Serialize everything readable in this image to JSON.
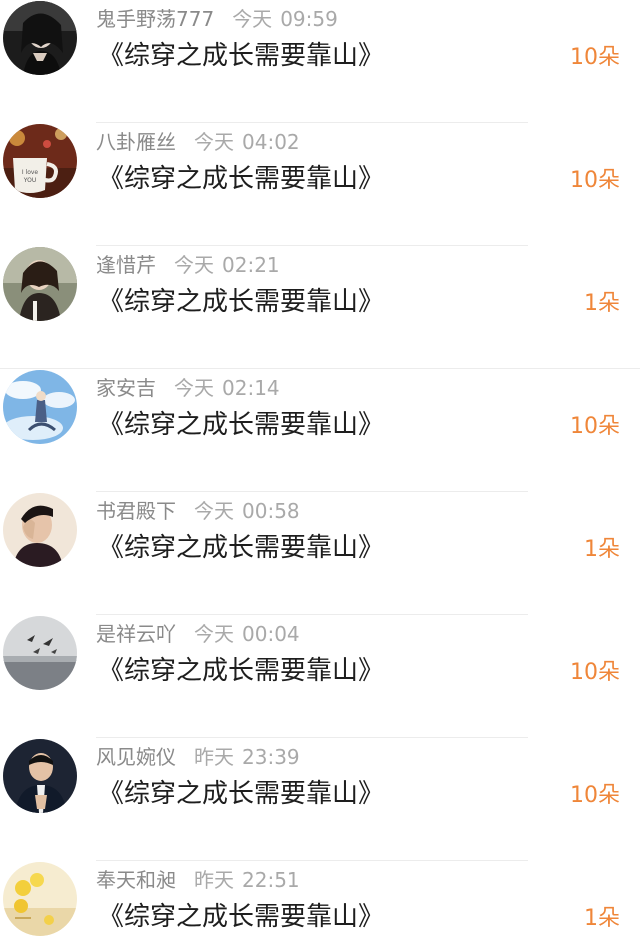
{
  "gift_list": {
    "items": [
      {
        "user": "鬼手野荡777",
        "day": "今天",
        "time": "09:59",
        "book": "《综穿之成长需要靠山》",
        "amount": "10朵",
        "avatar": "girl-dark-portrait"
      },
      {
        "user": "八卦雁丝",
        "day": "今天",
        "time": "04:02",
        "book": "《综穿之成长需要靠山》",
        "amount": "10朵",
        "avatar": "i-love-you-coffee-cup"
      },
      {
        "user": "逢惜芹",
        "day": "今天",
        "time": "02:21",
        "book": "《综穿之成长需要靠山》",
        "amount": "1朵",
        "avatar": "girl-sitting-portrait"
      },
      {
        "user": "家安吉",
        "day": "今天",
        "time": "02:14",
        "book": "《综穿之成长需要靠山》",
        "amount": "10朵",
        "avatar": "anime-sky-illustration"
      },
      {
        "user": "书君殿下",
        "day": "今天",
        "time": "00:58",
        "book": "《综穿之成长需要靠山》",
        "amount": "1朵",
        "avatar": "man-hand-on-face"
      },
      {
        "user": "是祥云吖",
        "day": "今天",
        "time": "00:04",
        "book": "《综穿之成长需要靠山》",
        "amount": "10朵",
        "avatar": "birds-over-sea"
      },
      {
        "user": "风见婉仪",
        "day": "昨天",
        "time": "23:39",
        "book": "《综穿之成长需要靠山》",
        "amount": "10朵",
        "avatar": "man-praying-hands"
      },
      {
        "user": "奉天和昶",
        "day": "昨天",
        "time": "22:51",
        "book": "《综穿之成长需要靠山》",
        "amount": "1朵",
        "avatar": "lemons-on-beach"
      }
    ]
  }
}
